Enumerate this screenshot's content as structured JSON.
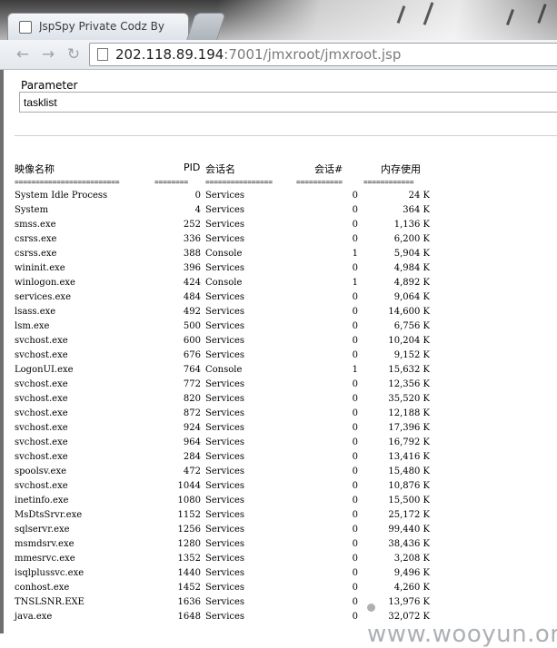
{
  "browser": {
    "tab_title": "JspSpy Private Codz By",
    "url_host": "202.118.89.194",
    "url_rest": ":7001/jmxroot/jmxroot.jsp"
  },
  "form": {
    "label": "Parameter",
    "value": "tasklist"
  },
  "table": {
    "headers": [
      "映像名称",
      "PID",
      "会话名",
      "会话#",
      "内存使用"
    ],
    "separator": [
      "=========================",
      "========",
      "================",
      "===========",
      "============"
    ],
    "rows": [
      [
        "System Idle Process",
        "0",
        "Services",
        "0",
        "24 K"
      ],
      [
        "System",
        "4",
        "Services",
        "0",
        "364 K"
      ],
      [
        "smss.exe",
        "252",
        "Services",
        "0",
        "1,136 K"
      ],
      [
        "csrss.exe",
        "336",
        "Services",
        "0",
        "6,200 K"
      ],
      [
        "csrss.exe",
        "388",
        "Console",
        "1",
        "5,904 K"
      ],
      [
        "wininit.exe",
        "396",
        "Services",
        "0",
        "4,984 K"
      ],
      [
        "winlogon.exe",
        "424",
        "Console",
        "1",
        "4,892 K"
      ],
      [
        "services.exe",
        "484",
        "Services",
        "0",
        "9,064 K"
      ],
      [
        "lsass.exe",
        "492",
        "Services",
        "0",
        "14,600 K"
      ],
      [
        "lsm.exe",
        "500",
        "Services",
        "0",
        "6,756 K"
      ],
      [
        "svchost.exe",
        "600",
        "Services",
        "0",
        "10,204 K"
      ],
      [
        "svchost.exe",
        "676",
        "Services",
        "0",
        "9,152 K"
      ],
      [
        "LogonUI.exe",
        "764",
        "Console",
        "1",
        "15,632 K"
      ],
      [
        "svchost.exe",
        "772",
        "Services",
        "0",
        "12,356 K"
      ],
      [
        "svchost.exe",
        "820",
        "Services",
        "0",
        "35,520 K"
      ],
      [
        "svchost.exe",
        "872",
        "Services",
        "0",
        "12,188 K"
      ],
      [
        "svchost.exe",
        "924",
        "Services",
        "0",
        "17,396 K"
      ],
      [
        "svchost.exe",
        "964",
        "Services",
        "0",
        "16,792 K"
      ],
      [
        "svchost.exe",
        "284",
        "Services",
        "0",
        "13,416 K"
      ],
      [
        "spoolsv.exe",
        "472",
        "Services",
        "0",
        "15,480 K"
      ],
      [
        "svchost.exe",
        "1044",
        "Services",
        "0",
        "10,876 K"
      ],
      [
        "inetinfo.exe",
        "1080",
        "Services",
        "0",
        "15,500 K"
      ],
      [
        "MsDtsSrvr.exe",
        "1152",
        "Services",
        "0",
        "25,172 K"
      ],
      [
        "sqlservr.exe",
        "1256",
        "Services",
        "0",
        "99,440 K"
      ],
      [
        "msmdsrv.exe",
        "1280",
        "Services",
        "0",
        "38,436 K"
      ],
      [
        "mmesrvc.exe",
        "1352",
        "Services",
        "0",
        "3,208 K"
      ],
      [
        "isqlplussvc.exe",
        "1440",
        "Services",
        "0",
        "9,496 K"
      ],
      [
        "conhost.exe",
        "1452",
        "Services",
        "0",
        "4,260 K"
      ],
      [
        "TNSLSNR.EXE",
        "1636",
        "Services",
        "0",
        "13,976 K"
      ],
      [
        "java.exe",
        "1648",
        "Services",
        "0",
        "32,072 K"
      ]
    ]
  },
  "watermark": "www.wooyun.org"
}
